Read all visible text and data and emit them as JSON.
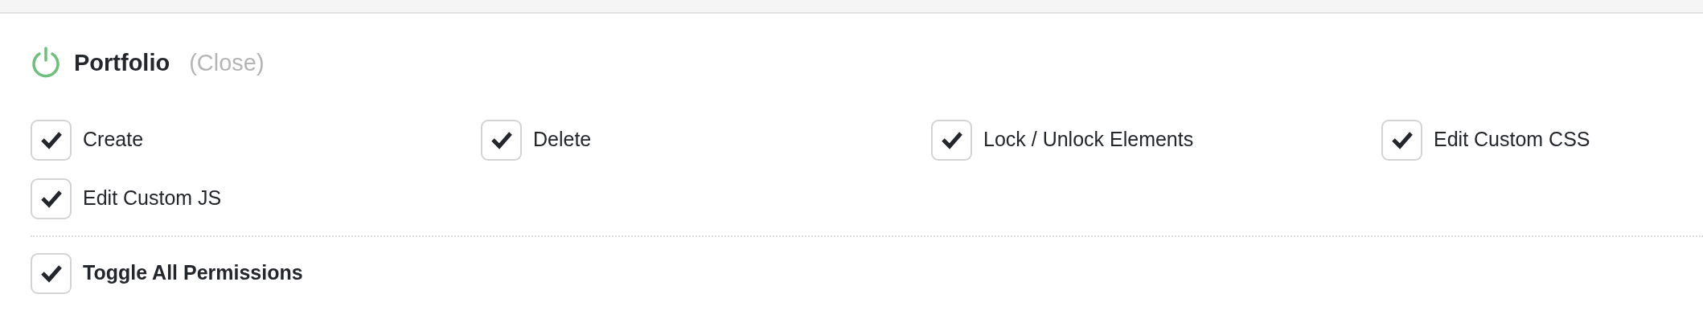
{
  "section": {
    "title": "Portfolio",
    "enabled": true,
    "close_link": "(Close)"
  },
  "permissions": [
    {
      "label": "Create",
      "checked": true
    },
    {
      "label": "Delete",
      "checked": true
    },
    {
      "label": "Lock / Unlock Elements",
      "checked": true
    },
    {
      "label": "Edit Custom CSS",
      "checked": true
    },
    {
      "label": "Edit Custom JS",
      "checked": true
    }
  ],
  "toggle_all": {
    "label": "Toggle All Permissions",
    "checked": true
  }
}
